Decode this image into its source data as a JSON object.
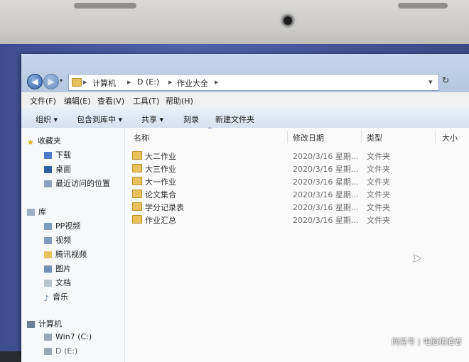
{
  "address_bar": {
    "segments": [
      "计算机",
      "D (E:)",
      "作业大全"
    ],
    "refresh_icon": "refresh-icon"
  },
  "menu": [
    "文件(F)",
    "编辑(E)",
    "查看(V)",
    "工具(T)",
    "帮助(H)"
  ],
  "toolbar": [
    "组织 ▾",
    "包含到库中 ▾",
    "共享 ▾",
    "刻录",
    "新建文件夹"
  ],
  "sidebar": {
    "favorites_title": "收藏夹",
    "favorites": [
      "下载",
      "桌面",
      "最近访问的位置"
    ],
    "libraries_title": "库",
    "libraries": [
      "PP视频",
      "视频",
      "腾讯视频",
      "图片",
      "文档",
      "音乐"
    ],
    "computer_title": "计算机",
    "drives": [
      "Win7 (C:)",
      "D (E:)"
    ]
  },
  "columns": {
    "name": "名称",
    "modified": "修改日期",
    "type": "类型",
    "size": "大小"
  },
  "files": [
    {
      "name": "大二作业",
      "date": "2020/3/16 星期...",
      "type": "文件夹"
    },
    {
      "name": "大三作业",
      "date": "2020/3/16 星期...",
      "type": "文件夹"
    },
    {
      "name": "大一作业",
      "date": "2020/3/16 星期...",
      "type": "文件夹"
    },
    {
      "name": "论文集合",
      "date": "2020/3/16 星期...",
      "type": "文件夹"
    },
    {
      "name": "学分记录表",
      "date": "2020/3/16 星期...",
      "type": "文件夹"
    },
    {
      "name": "作业汇总",
      "date": "2020/3/16 星期...",
      "type": "文件夹"
    }
  ],
  "watermark": {
    "brand": "网易号",
    "separator": "|",
    "author": "电脑精通者"
  }
}
